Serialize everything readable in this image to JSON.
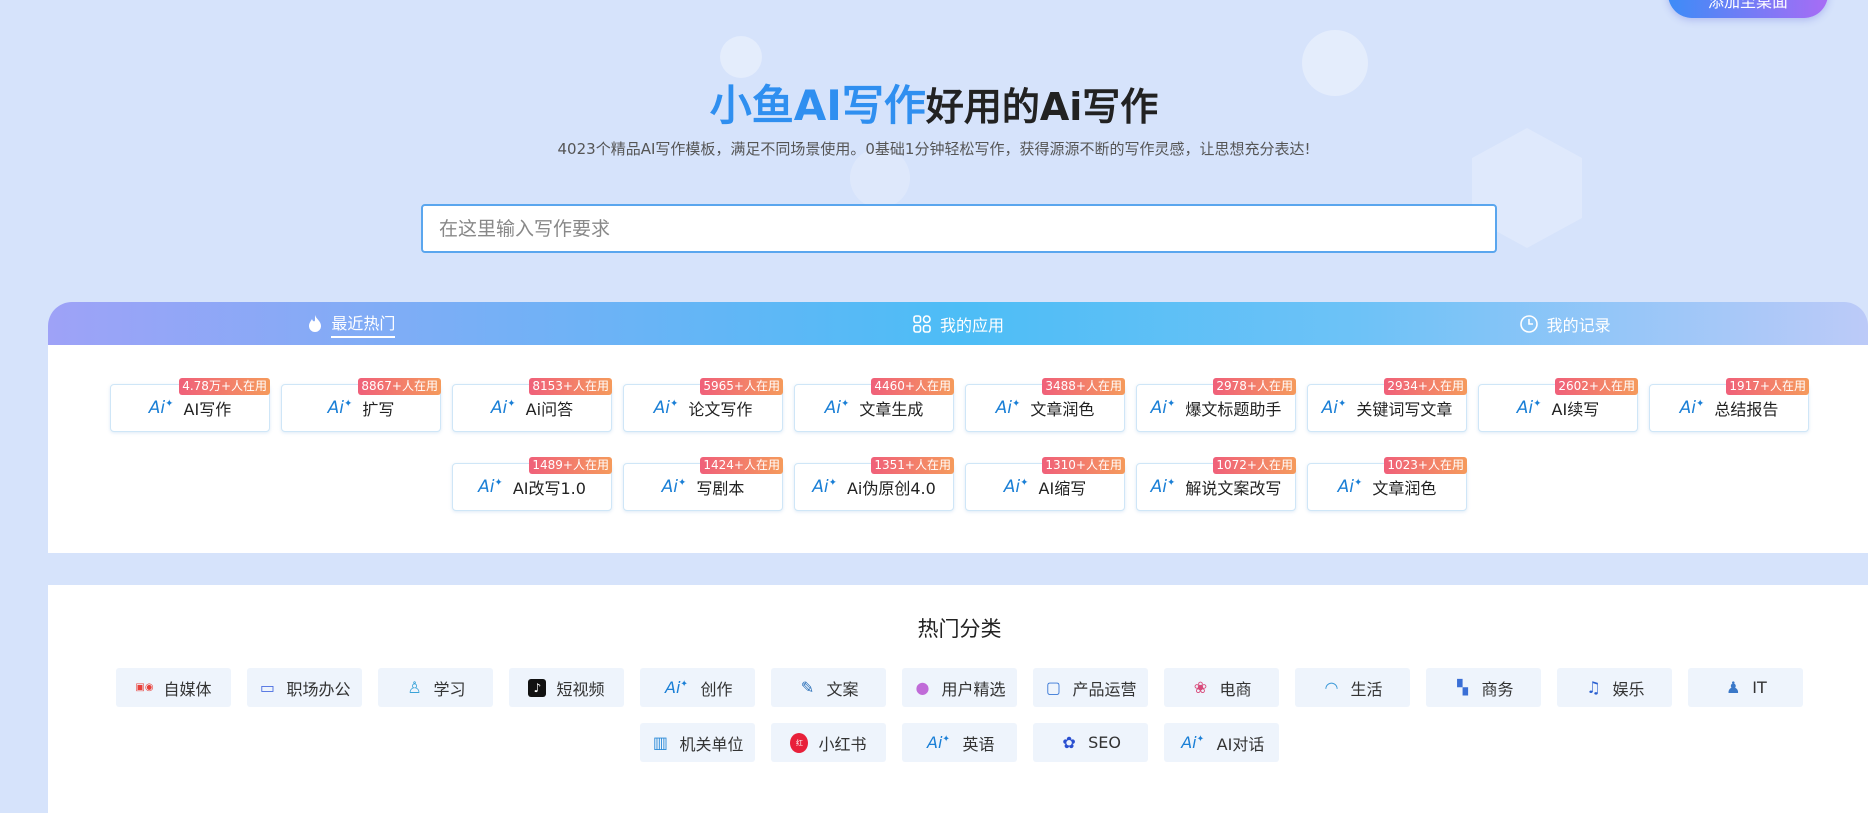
{
  "hero": {
    "brand": "小鱼AI写作",
    "slogan": "好用的Ai写作",
    "subtitle": "4023个精品AI写作模板，满足不同场景使用。0基础1分钟轻松写作，获得源源不断的写作灵感，让思想充分表达!",
    "search_placeholder": "在这里输入写作要求"
  },
  "corner_button": {
    "label": "添加至桌面"
  },
  "tabs": [
    {
      "label": "最近热门",
      "icon": "flame-icon"
    },
    {
      "label": "我的应用",
      "icon": "grid-icon"
    },
    {
      "label": "我的记录",
      "icon": "clock-icon"
    }
  ],
  "apps": [
    {
      "label": "AI写作",
      "badge": "4.78万+人在用"
    },
    {
      "label": "扩写",
      "badge": "8867+人在用"
    },
    {
      "label": "Ai问答",
      "badge": "8153+人在用"
    },
    {
      "label": "论文写作",
      "badge": "5965+人在用"
    },
    {
      "label": "文章生成",
      "badge": "4460+人在用"
    },
    {
      "label": "文章润色",
      "badge": "3488+人在用"
    },
    {
      "label": "爆文标题助手",
      "badge": "2978+人在用"
    },
    {
      "label": "关键词写文章",
      "badge": "2934+人在用"
    },
    {
      "label": "AI续写",
      "badge": "2602+人在用"
    },
    {
      "label": "总结报告",
      "badge": "1917+人在用"
    },
    {
      "label": "AI改写1.0",
      "badge": "1489+人在用"
    },
    {
      "label": "写剧本",
      "badge": "1424+人在用"
    },
    {
      "label": "Ai伪原创4.0",
      "badge": "1351+人在用"
    },
    {
      "label": "AI缩写",
      "badge": "1310+人在用"
    },
    {
      "label": "解说文案改写",
      "badge": "1072+人在用"
    },
    {
      "label": "文章润色",
      "badge": "1023+人在用"
    }
  ],
  "ai_icon_text": "Ai",
  "categories_title": "热门分类",
  "categories": [
    {
      "label": "自媒体",
      "icon": "media-logos-icon",
      "color": "#e8403a"
    },
    {
      "label": "职场办公",
      "icon": "briefcase-icon",
      "color": "#4a6de0"
    },
    {
      "label": "学习",
      "icon": "person-icon",
      "color": "#3aa3d8"
    },
    {
      "label": "短视频",
      "icon": "tiktok-icon",
      "color": "#111111"
    },
    {
      "label": "创作",
      "icon": "ai-icon",
      "color": "#1a7fd6"
    },
    {
      "label": "文案",
      "icon": "pen-icon",
      "color": "#2a6fb8"
    },
    {
      "label": "用户精选",
      "icon": "user-group-icon",
      "color": "#c06bd8"
    },
    {
      "label": "产品运营",
      "icon": "monitor-chart-icon",
      "color": "#3a78d6"
    },
    {
      "label": "电商",
      "icon": "shop-icon",
      "color": "#d84a7a"
    },
    {
      "label": "生活",
      "icon": "teapot-icon",
      "color": "#3a98d8"
    },
    {
      "label": "商务",
      "icon": "handshake-icon",
      "color": "#3a6fd6"
    },
    {
      "label": "娱乐",
      "icon": "music-icon",
      "color": "#2a5fd0"
    },
    {
      "label": "IT",
      "icon": "engineer-icon",
      "color": "#3a78c8"
    },
    {
      "label": "机关单位",
      "icon": "building-icon",
      "color": "#2a8ad8"
    },
    {
      "label": "小红书",
      "icon": "xiaohongshu-icon",
      "color": "#e8203a"
    },
    {
      "label": "英语",
      "icon": "ai-icon",
      "color": "#1a7fd6"
    },
    {
      "label": "SEO",
      "icon": "baidu-paw-icon",
      "color": "#2a4fd0"
    },
    {
      "label": "AI对话",
      "icon": "ai-icon",
      "color": "#1a7fd6"
    }
  ]
}
